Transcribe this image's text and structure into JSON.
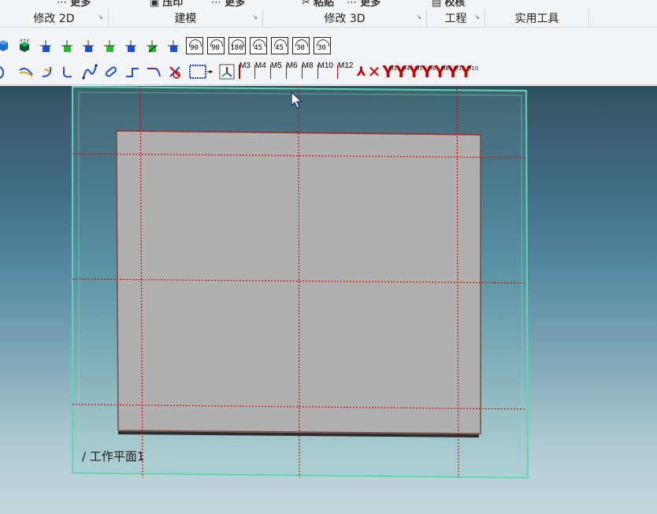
{
  "ribbon": {
    "top_row": [
      "更多",
      "压印",
      "更多",
      "粘贴",
      "更多",
      "校核"
    ],
    "groups": [
      {
        "label": "修改 2D"
      },
      {
        "label": "建模"
      },
      {
        "label": "修改 3D"
      },
      {
        "label": "工程"
      },
      {
        "label": "实用工具"
      }
    ],
    "rotate_buttons": [
      "90",
      "90",
      "180",
      "45",
      "45",
      "30",
      "30"
    ],
    "m_tags": [
      "M3",
      "M4",
      "M5",
      "M6",
      "M8",
      "M10",
      "M12"
    ],
    "y_tags": [
      "M3",
      "M4",
      "M5",
      "M6",
      "M8",
      "M10",
      "M10"
    ]
  },
  "viewport": {
    "workplane_label": "/ 工作平面1",
    "colors": {
      "plane_fill": "#b0b0b0",
      "workplane_edge": "#5fd6b2",
      "grid_line": "#e00000"
    }
  }
}
